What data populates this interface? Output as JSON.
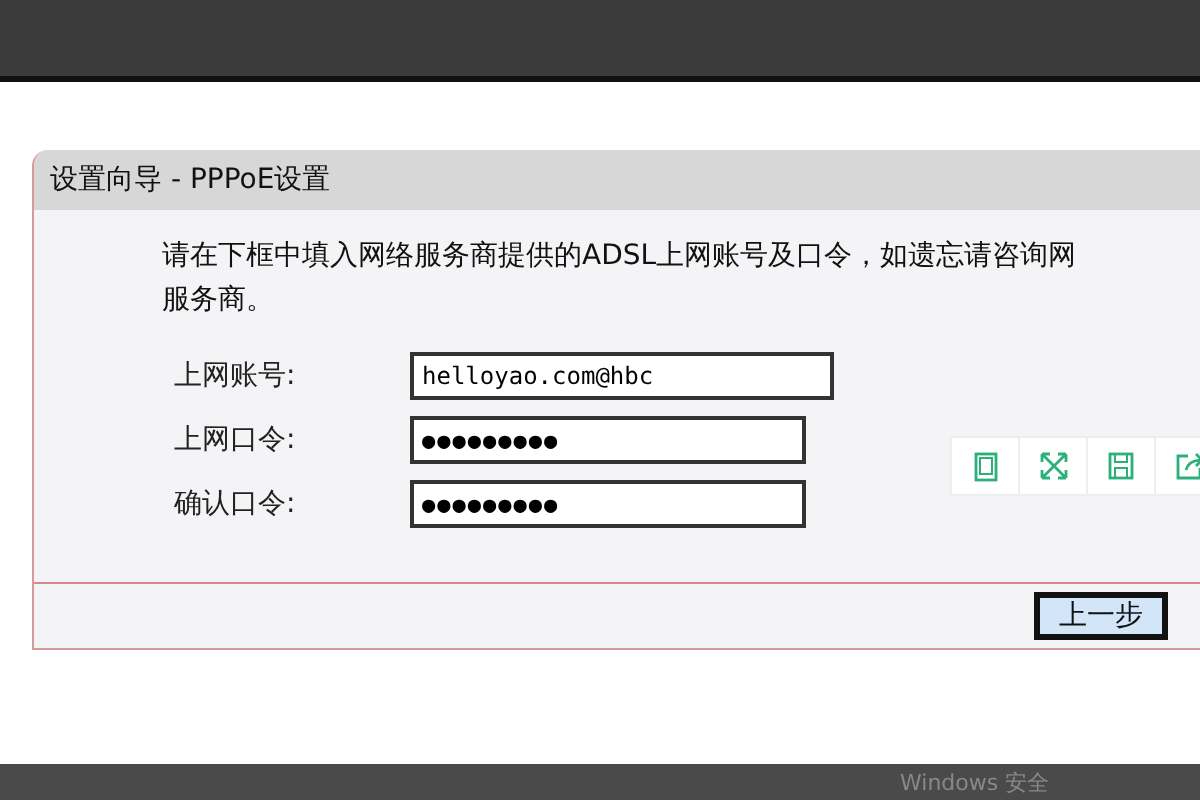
{
  "panel": {
    "title": "设置向导 - PPPoE设置",
    "intro": [
      "请在下框中填入网络服务商提供的ADSL上网账号及口令，如遗忘请咨询网",
      "服务商。"
    ],
    "fields": [
      {
        "label": "上网账号:",
        "value": "helloyao.com@hbc",
        "kind": "text"
      },
      {
        "label": "上网口令:",
        "value": "●●●●●●●●●",
        "kind": "password"
      },
      {
        "label": "确认口令:",
        "value": "●●●●●●●●●",
        "kind": "password"
      }
    ],
    "buttons": [
      "上一步"
    ]
  },
  "toolbar": {
    "items": [
      {
        "kind": "tablet"
      },
      {
        "kind": "expand"
      },
      {
        "kind": "save"
      },
      {
        "kind": "share"
      }
    ]
  },
  "taskbar": {
    "label": "Windows 安全"
  }
}
